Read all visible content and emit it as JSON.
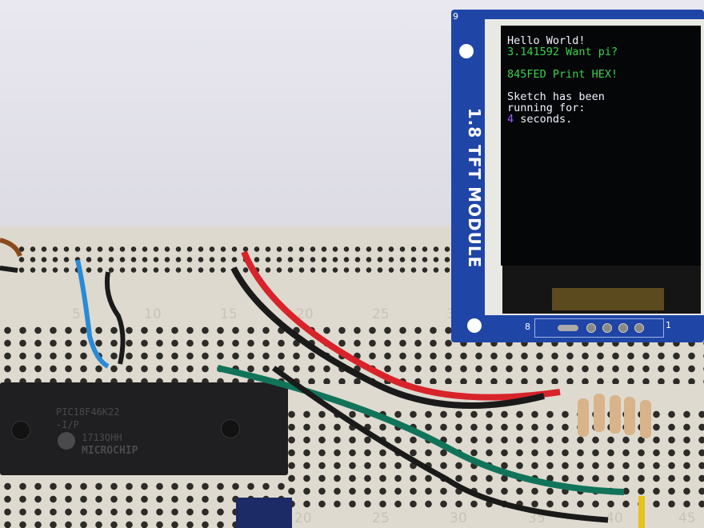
{
  "tft_screen": {
    "line1": "Hello World!",
    "line2": "3.141592 Want pi?",
    "line3": "845FED Print HEX!",
    "line4": "Sketch has been",
    "line5": "running for:",
    "seconds_value": "4",
    "seconds_label": " seconds.",
    "colors": {
      "white": "#f2f2ff",
      "green": "#38d24a",
      "purple": "#a05cff"
    }
  },
  "module": {
    "label": "1.8 TFT MODULE",
    "pin_label_left": "8",
    "pin_label_right": "1",
    "corner_label": "9",
    "board_color": "#1f45a6"
  },
  "chip": {
    "part": "PIC18F46K22",
    "package": "-I/P",
    "lot": "1713QHH",
    "brand": "MICROCHIP"
  },
  "breadboard": {
    "top_numbers": [
      "5",
      "10",
      "15",
      "20",
      "25",
      "30"
    ],
    "bottom_numbers": [
      "20",
      "25",
      "30",
      "35",
      "40",
      "45"
    ]
  },
  "wire_colors": {
    "red": "#d8232a",
    "black": "#1a1a1a",
    "green": "#11745a",
    "blue": "#2a8ad6"
  }
}
